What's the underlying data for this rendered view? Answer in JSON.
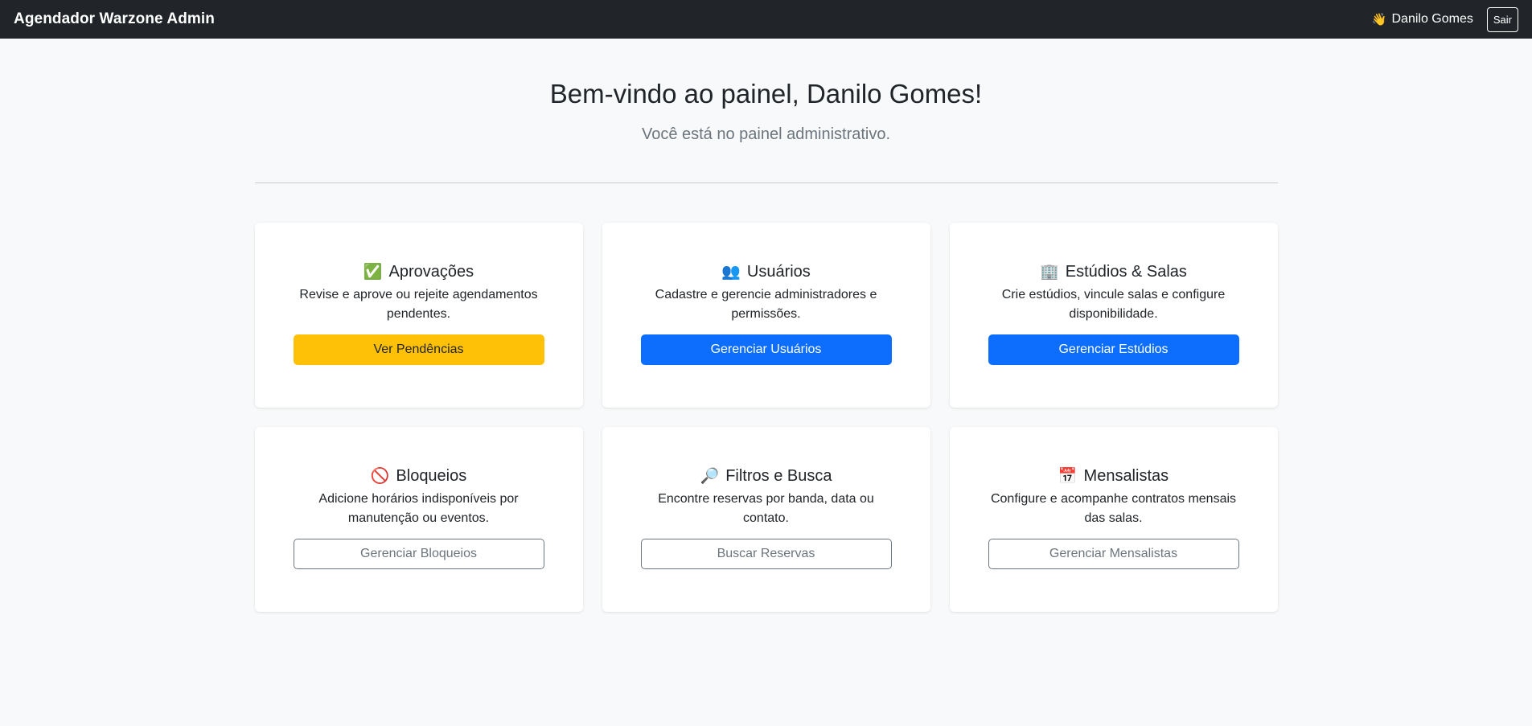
{
  "navbar": {
    "brand": "Agendador Warzone Admin",
    "user_icon": "👋",
    "user_name": "Danilo Gomes",
    "logout_label": "Sair"
  },
  "hero": {
    "title": "Bem-vindo ao painel, Danilo Gomes!",
    "subtitle": "Você está no painel administrativo."
  },
  "cards": [
    {
      "icon": "✅",
      "icon_name": "check-icon",
      "title": "Aprovações",
      "text": "Revise e aprove ou rejeite agendamentos pendentes.",
      "button": "Ver Pendências",
      "button_style": "warning"
    },
    {
      "icon": "👥",
      "icon_name": "users-icon",
      "title": "Usuários",
      "text": "Cadastre e gerencie administradores e permissões.",
      "button": "Gerenciar Usuários",
      "button_style": "primary"
    },
    {
      "icon": "🏢",
      "icon_name": "building-icon",
      "title": "Estúdios & Salas",
      "text": "Crie estúdios, vincule salas e configure disponibilidade.",
      "button": "Gerenciar Estúdios",
      "button_style": "primary"
    },
    {
      "icon": "🚫",
      "icon_name": "prohibited-icon",
      "title": "Bloqueios",
      "text": "Adicione horários indisponíveis por manutenção ou eventos.",
      "button": "Gerenciar Bloqueios",
      "button_style": "outline"
    },
    {
      "icon": "🔎",
      "icon_name": "magnifier-icon",
      "title": "Filtros e Busca",
      "text": "Encontre reservas por banda, data ou contato.",
      "button": "Buscar Reservas",
      "button_style": "outline"
    },
    {
      "icon": "📅",
      "icon_name": "calendar-icon",
      "title": "Mensalistas",
      "text": "Configure e acompanhe contratos mensais das salas.",
      "button": "Gerenciar Mensalistas",
      "button_style": "outline"
    }
  ],
  "colors": {
    "navbar_bg": "#212529",
    "page_bg": "#f8f9fa",
    "warning": "#ffc107",
    "primary": "#0d6efd",
    "secondary": "#6c757d"
  }
}
